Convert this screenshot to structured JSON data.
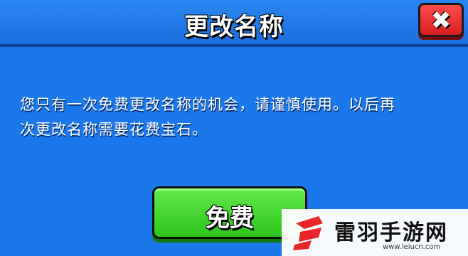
{
  "dialog": {
    "title": "更改名称",
    "close_icon": "close-icon",
    "message_lines": [
      "您只有一次免费更改名称的机会，请谨慎使用。以后再",
      "次更改名称需要花费宝石。"
    ],
    "free_button_label": "免费"
  },
  "watermark": {
    "name": "雷羽手游网",
    "url": "www.leiucn.com"
  },
  "colors": {
    "background": "#1a78ea",
    "close_button": "#e42a2a",
    "free_button": "#3fd22a",
    "watermark_logo": "#e8262a"
  }
}
